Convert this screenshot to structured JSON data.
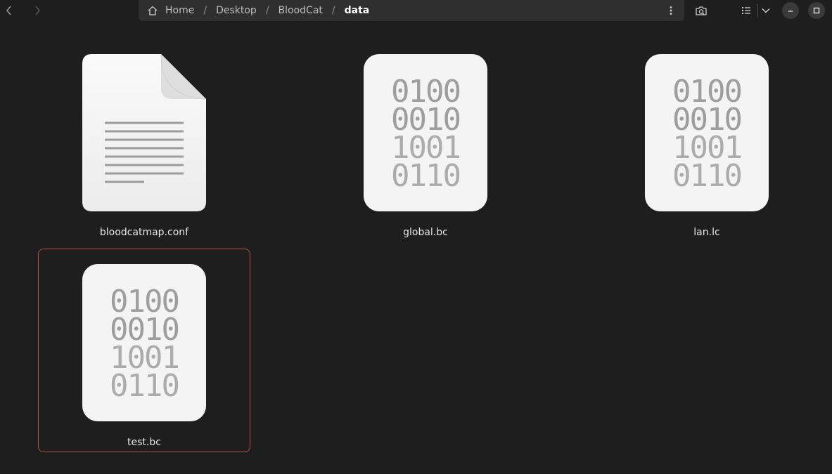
{
  "navigation": {
    "back_label": "Back",
    "forward_label": "Forward"
  },
  "pathbar": {
    "crumbs": [
      "Home",
      "Desktop",
      "BloodCat",
      "data"
    ],
    "separator": "/"
  },
  "toolbar": {
    "icons": [
      "menu-icon",
      "search-icon",
      "list-view-icon",
      "chevron-down-icon"
    ]
  },
  "window": {
    "icons": [
      "minimize-icon",
      "maximize-icon"
    ]
  },
  "binary_rows": [
    "0100",
    "0010",
    "1001",
    "0110"
  ],
  "files": [
    {
      "name": "bloodcatmap.conf",
      "type": "text",
      "selected": false
    },
    {
      "name": "global.bc",
      "type": "binary",
      "selected": false
    },
    {
      "name": "lan.lc",
      "type": "binary",
      "selected": false
    },
    {
      "name": "test.bc",
      "type": "binary",
      "selected": true
    }
  ],
  "colors": {
    "background": "#1e1e1e",
    "pathbar": "#2f2f2f",
    "selection": "#b3543c"
  }
}
